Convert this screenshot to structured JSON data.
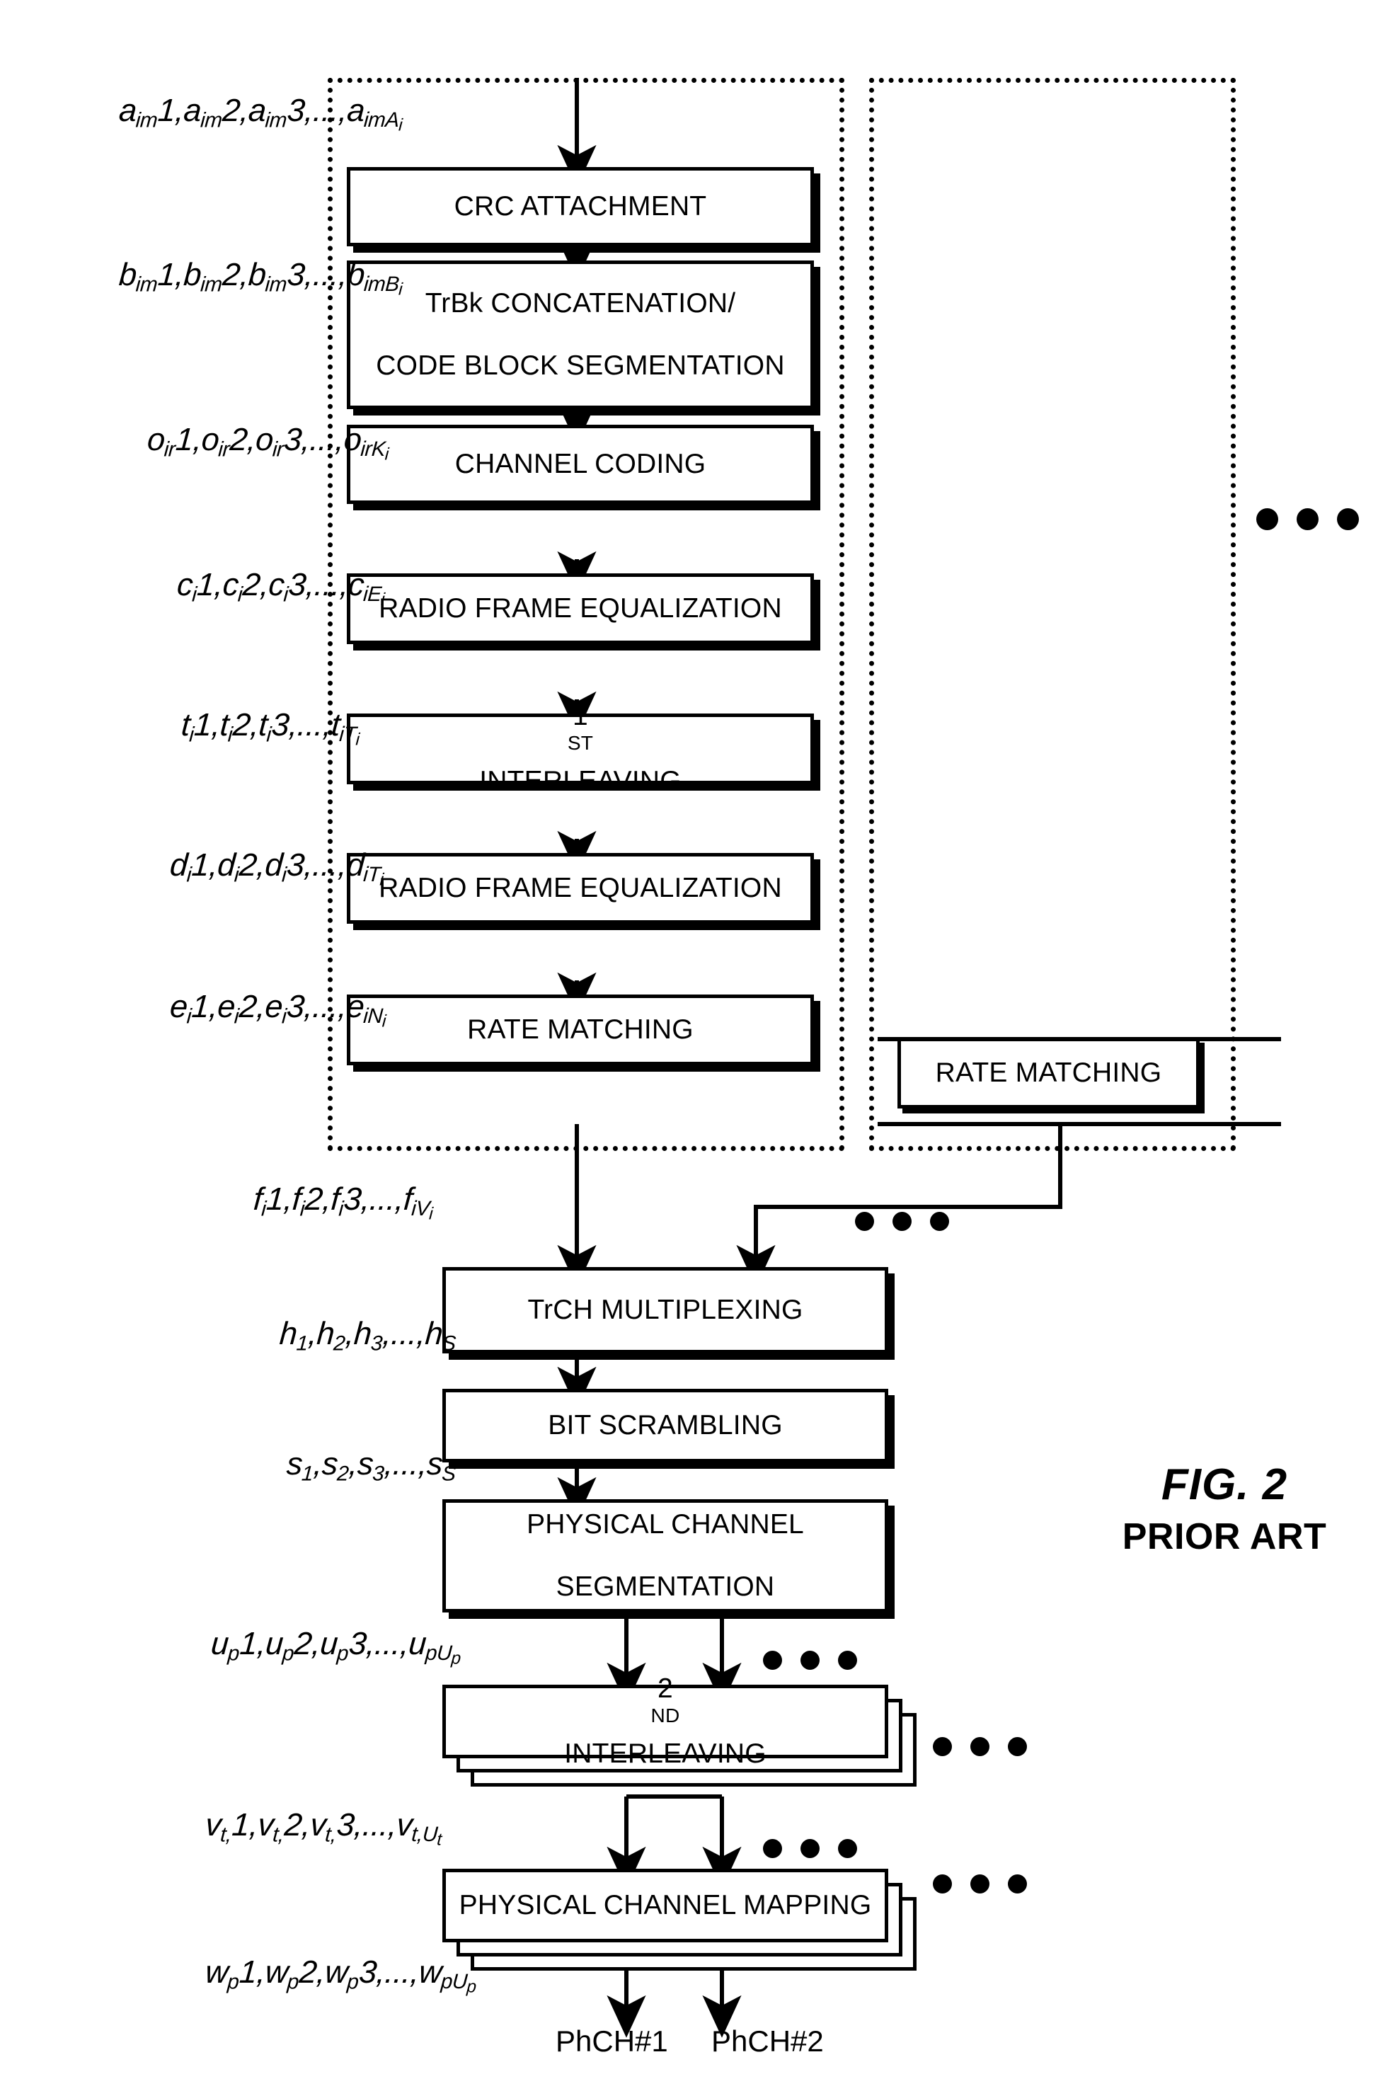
{
  "figure": {
    "title": "FIG. 2",
    "subtitle": "PRIOR ART",
    "type": "block-diagram",
    "description": "Transport channel multiplexing / physical channel mapping chain"
  },
  "blocks": [
    {
      "id": "crc",
      "label": "CRC ATTACHMENT"
    },
    {
      "id": "trbk",
      "label_line1": "TrBk CONCATENATION/",
      "label_line2": "CODE BLOCK SEGMENTATION"
    },
    {
      "id": "chcod",
      "label": "CHANNEL CODING"
    },
    {
      "id": "rfe1",
      "label": "RADIO FRAME EQUALIZATION"
    },
    {
      "id": "intl1",
      "label_pre": "1",
      "label_sup": "ST",
      "label_post": " INTERLEAVING"
    },
    {
      "id": "rfe2",
      "label": "RADIO FRAME EQUALIZATION"
    },
    {
      "id": "rm1",
      "label": "RATE MATCHING"
    },
    {
      "id": "rm2",
      "label": "RATE MATCHING"
    },
    {
      "id": "trchmux",
      "label": "TrCH MULTIPLEXING"
    },
    {
      "id": "bitscr",
      "label": "BIT SCRAMBLING"
    },
    {
      "id": "pcseg",
      "label_line1": "PHYSICAL CHANNEL",
      "label_line2": "SEGMENTATION"
    },
    {
      "id": "intl2",
      "label_pre": "2",
      "label_sup": "ND",
      "label_post": " INTERLEAVING"
    },
    {
      "id": "pcmap",
      "label": "PHYSICAL CHANNEL MAPPING"
    }
  ],
  "signals": [
    {
      "id": "a",
      "base": "a",
      "sub": "im",
      "items": "1,2,3",
      "last_sub": "imA",
      "last_sub_sub": "i"
    },
    {
      "id": "b",
      "base": "b",
      "sub": "im",
      "items": "1,2,3",
      "last_sub": "imB",
      "last_sub_sub": "i"
    },
    {
      "id": "o",
      "base": "o",
      "sub": "ir",
      "items": "1,2,3",
      "last_sub": "irK",
      "last_sub_sub": "i"
    },
    {
      "id": "c",
      "base": "c",
      "sub": "i",
      "items": "1,2,3",
      "last_sub": "iE",
      "last_sub_sub": "i"
    },
    {
      "id": "t",
      "base": "t",
      "sub": "i",
      "items": "1,2,3",
      "last_sub": "iT",
      "last_sub_sub": "i"
    },
    {
      "id": "d",
      "base": "d",
      "sub": "i",
      "items": "1,2,3",
      "last_sub": "iT",
      "last_sub_sub": "i"
    },
    {
      "id": "e",
      "base": "e",
      "sub": "i",
      "items": "1,2,3",
      "last_sub": "iN",
      "last_sub_sub": "i"
    },
    {
      "id": "f",
      "base": "f",
      "sub": "i",
      "items": "1,2,3",
      "last_sub": "iV",
      "last_sub_sub": "i"
    },
    {
      "id": "h",
      "base": "h",
      "sub": "",
      "items": "1,2,3",
      "last_sub": "S",
      "last_sub_sub": ""
    },
    {
      "id": "s",
      "base": "s",
      "sub": "",
      "items": "1,2,3",
      "last_sub": "S",
      "last_sub_sub": ""
    },
    {
      "id": "u",
      "base": "u",
      "sub": "p",
      "items": "1,2,3",
      "last_sub": "pU",
      "last_sub_sub": "p"
    },
    {
      "id": "v",
      "base": "v",
      "sub": "t,",
      "items": "1,2,3",
      "last_sub": "t,U",
      "last_sub_sub": "t"
    },
    {
      "id": "w",
      "base": "w",
      "sub": "p",
      "items": "1,2,3",
      "last_sub": "pU",
      "last_sub_sub": "p"
    }
  ],
  "signal_text": {
    "a": "aim1,aim2,aim3,...,aimAi",
    "b": "bim1,bim2,bim3,...,bimBi",
    "o": "oir1,oir2,oir3,...,oirKi",
    "c": "ci1,ci2,ci3,...,ciEi",
    "t": "ti1,ti2,ti3,...,tiTi",
    "d": "di1,di2,di3,...,diTi",
    "e": "ei1,ei2,ei3,...,eiNi",
    "f": "fi1,fi2,fi3,...,fiVi",
    "h": "h1,h2,h3,...,hS",
    "s": "s1,s2,s3,...,sS",
    "u": "up1,up2,up3,...,upUp",
    "v": "vt,1,vt,2,vt,3,...,vt,Ut",
    "w": "wp1,wp2,wp3,...,wpUp"
  },
  "outputs": [
    {
      "id": "phch1",
      "label": "PhCH#1"
    },
    {
      "id": "phch2",
      "label": "PhCH#2"
    }
  ],
  "groups": [
    {
      "id": "trch-group-1",
      "note": "dotted transport-channel boundary (left)"
    },
    {
      "id": "trch-group-2",
      "note": "dotted transport-channel boundary (right)"
    }
  ],
  "ellipses": [
    {
      "id": "trch-repeat-right",
      "glyph": "•••"
    },
    {
      "id": "rm-repeat",
      "glyph": "•••"
    },
    {
      "id": "mux-input-repeat",
      "glyph": "•••"
    },
    {
      "id": "pcseg-out-repeat",
      "glyph": "•••"
    },
    {
      "id": "intl2-repeat",
      "glyph": "•••"
    },
    {
      "id": "pcmap-repeat",
      "glyph": "•••"
    }
  ],
  "colors": {
    "ink": "#000000",
    "paper": "#ffffff"
  }
}
